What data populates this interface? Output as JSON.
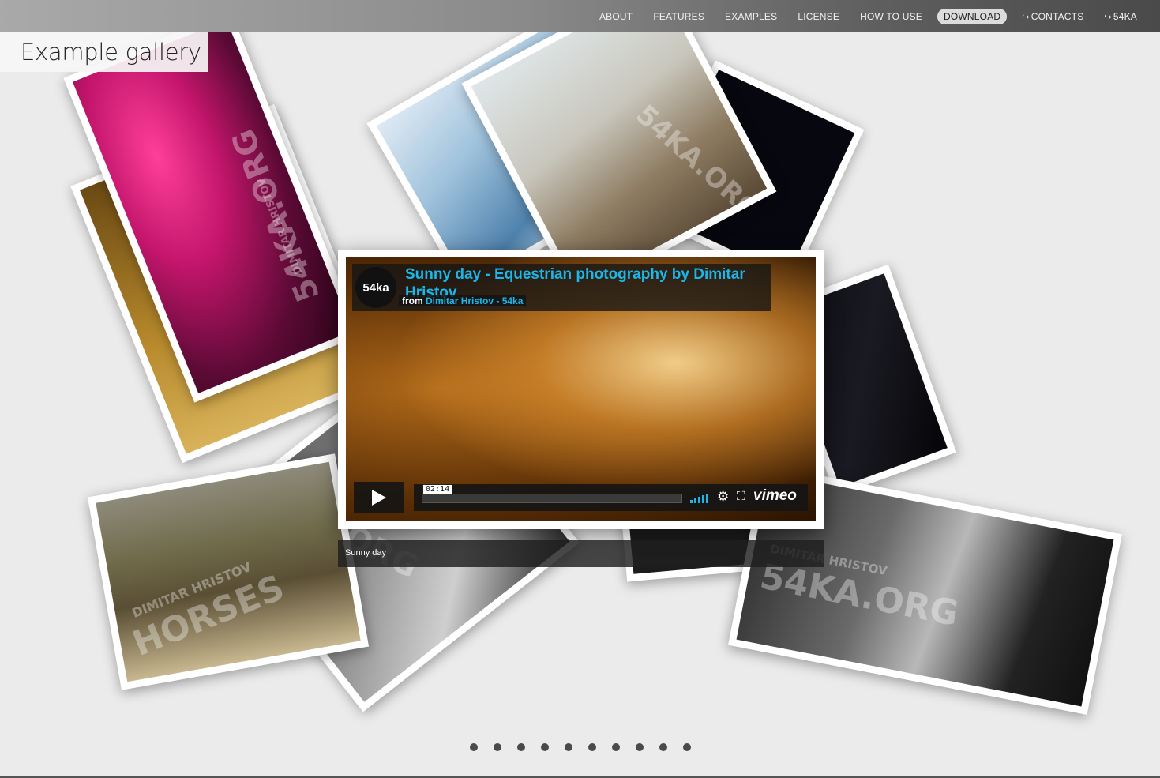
{
  "nav": {
    "items": [
      {
        "label": "ABOUT"
      },
      {
        "label": "FEATURES"
      },
      {
        "label": "EXAMPLES"
      },
      {
        "label": "LICENSE"
      },
      {
        "label": "HOW TO USE"
      },
      {
        "label": "DOWNLOAD"
      },
      {
        "label": "CONTACTS"
      },
      {
        "label": "54KA"
      }
    ],
    "arrow": "↪"
  },
  "page": {
    "title": "Example gallery"
  },
  "video": {
    "logo": "54ka",
    "title": "Sunny day - Equestrian photography by Dimitar Hristov",
    "from_label": "from",
    "from_author": "Dimitar Hristov - 54ka",
    "time": "02:14",
    "brand": "vimeo",
    "gear_icon": "⚙",
    "fullscreen_icon": "⛶"
  },
  "caption": {
    "text": "Sunny day"
  },
  "watermarks": {
    "brand": "54KA.ORG",
    "author": "DIMITAR HRISTOV",
    "horses": "HORSES"
  },
  "pagination": {
    "count": 10
  }
}
